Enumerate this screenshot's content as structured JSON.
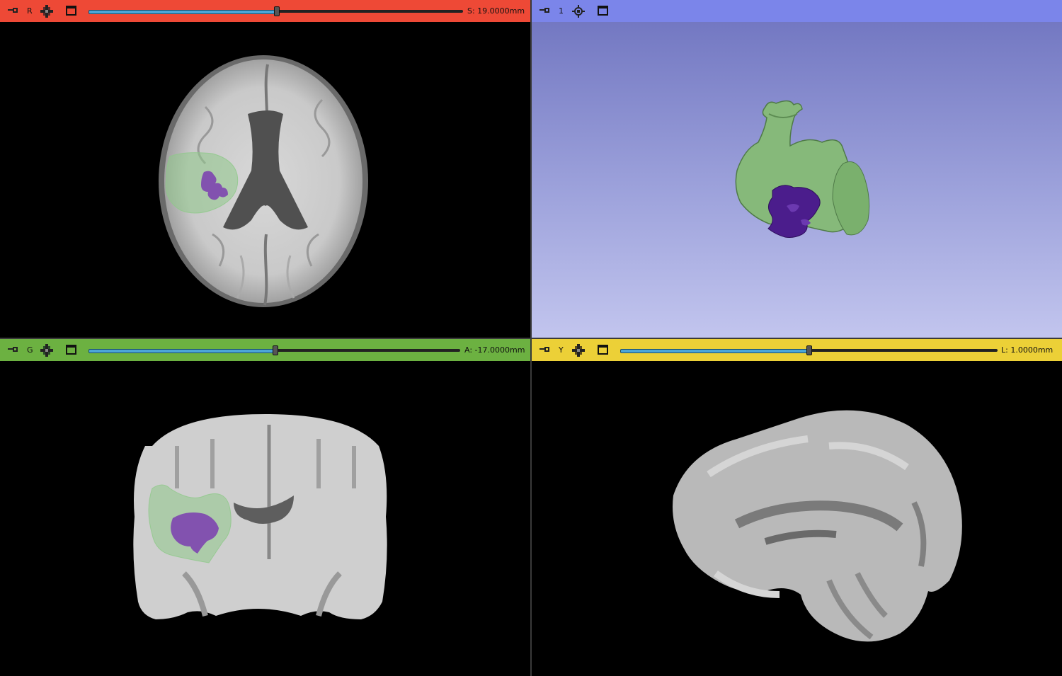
{
  "views": {
    "red": {
      "label": "R",
      "offset": "S: 19.0000mm",
      "slider_fraction": 0.5,
      "color": "#ee4936"
    },
    "threed": {
      "label": "1",
      "color": "#7b85ea"
    },
    "green": {
      "label": "G",
      "offset": "A: -17.0000mm",
      "slider_fraction": 0.5,
      "color": "#6cb141"
    },
    "yellow": {
      "label": "Y",
      "offset": "L: 1.0000mm",
      "slider_fraction": 0.5,
      "color": "#ecd037"
    }
  },
  "icons": {
    "pin": "pin-icon",
    "link": "link-icon",
    "center": "center-view-icon",
    "maximize": "maximize-view-icon"
  },
  "segments": {
    "edema_color": "#8fc98a",
    "tumor_core_color": "#5b2b8f"
  }
}
